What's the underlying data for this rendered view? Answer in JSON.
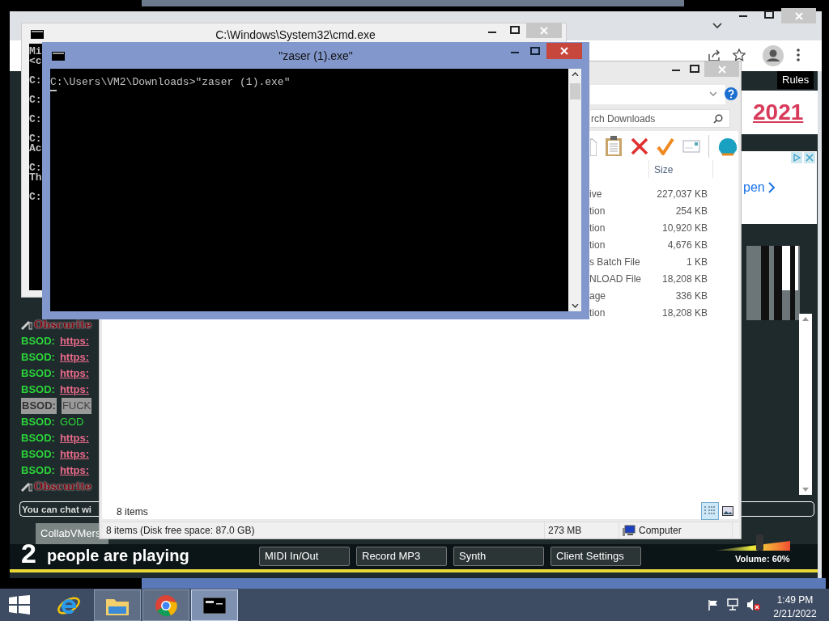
{
  "browser": {
    "page": {
      "rules_button": "Rules",
      "heading_link": "2021",
      "ad_text": "pen",
      "chat": [
        {
          "kind": "header",
          "user": "Obscurite"
        },
        {
          "kind": "link",
          "user": "BSOD:",
          "text": "https:"
        },
        {
          "kind": "link",
          "user": "BSOD:",
          "text": "https:"
        },
        {
          "kind": "link",
          "user": "BSOD:",
          "text": "https:"
        },
        {
          "kind": "link",
          "user": "BSOD:",
          "text": "https:"
        },
        {
          "kind": "muted",
          "user": "BSOD:",
          "text": "FUCK"
        },
        {
          "kind": "plain",
          "user": "BSOD:",
          "text": "GOD"
        },
        {
          "kind": "link",
          "user": "BSOD:",
          "text": "https:"
        },
        {
          "kind": "link",
          "user": "BSOD:",
          "text": "https:"
        },
        {
          "kind": "link",
          "user": "BSOD:",
          "text": "https:"
        },
        {
          "kind": "header",
          "user": "Obscurite"
        }
      ],
      "chat_input": {
        "placeholder": "You can chat wi"
      },
      "user_tab": "CollabVMers",
      "players": {
        "count": "2",
        "label": "people are playing"
      },
      "buttons": [
        "MIDI In/Out",
        "Record MP3",
        "Synth",
        "Client Settings"
      ],
      "volume": {
        "level": 0.6,
        "reading": "Volume: 60%"
      }
    }
  },
  "explorer": {
    "search": {
      "placeholder": "rch Downloads"
    },
    "columns": [
      "Size"
    ],
    "rows": [
      {
        "type": "ive",
        "size": "227,037 KB"
      },
      {
        "type": "tion",
        "size": "254 KB"
      },
      {
        "type": "tion",
        "size": "10,920 KB"
      },
      {
        "type": "tion",
        "size": "4,676 KB"
      },
      {
        "type": "s Batch File",
        "size": "1 KB"
      },
      {
        "type": "NLOAD File",
        "size": "18,208 KB"
      },
      {
        "type": "age",
        "size": "336 KB"
      },
      {
        "type": "tion",
        "size": "18,208 KB"
      }
    ],
    "item_count": "8 items",
    "status_bar": [
      "8 items (Disk free space: 87.0 GB)",
      "273 MB",
      "Computer"
    ]
  },
  "console_back": {
    "title": "C:\\Windows\\System32\\cmd.exe",
    "blocks": [
      [
        "Mi",
        "<c"
      ],
      [
        "C:"
      ],
      [
        "C:"
      ],
      [
        "C:"
      ],
      [
        "C:",
        "Ac"
      ],
      [
        "C:",
        "Th"
      ],
      [
        "C:"
      ]
    ]
  },
  "console_front": {
    "title": "\"zaser (1).exe\"",
    "lines": [
      "C:\\Users\\VM2\\Downloads>\"zaser (1).exe\""
    ],
    "cursor": true
  },
  "taskbar": {
    "items": [
      {
        "kind": "ie",
        "selected": false
      },
      {
        "kind": "folder",
        "selected": false
      },
      {
        "kind": "chrome",
        "selected": false
      },
      {
        "kind": "console",
        "selected": true
      }
    ],
    "time": "1:49 PM",
    "date": "2/21/2022"
  }
}
